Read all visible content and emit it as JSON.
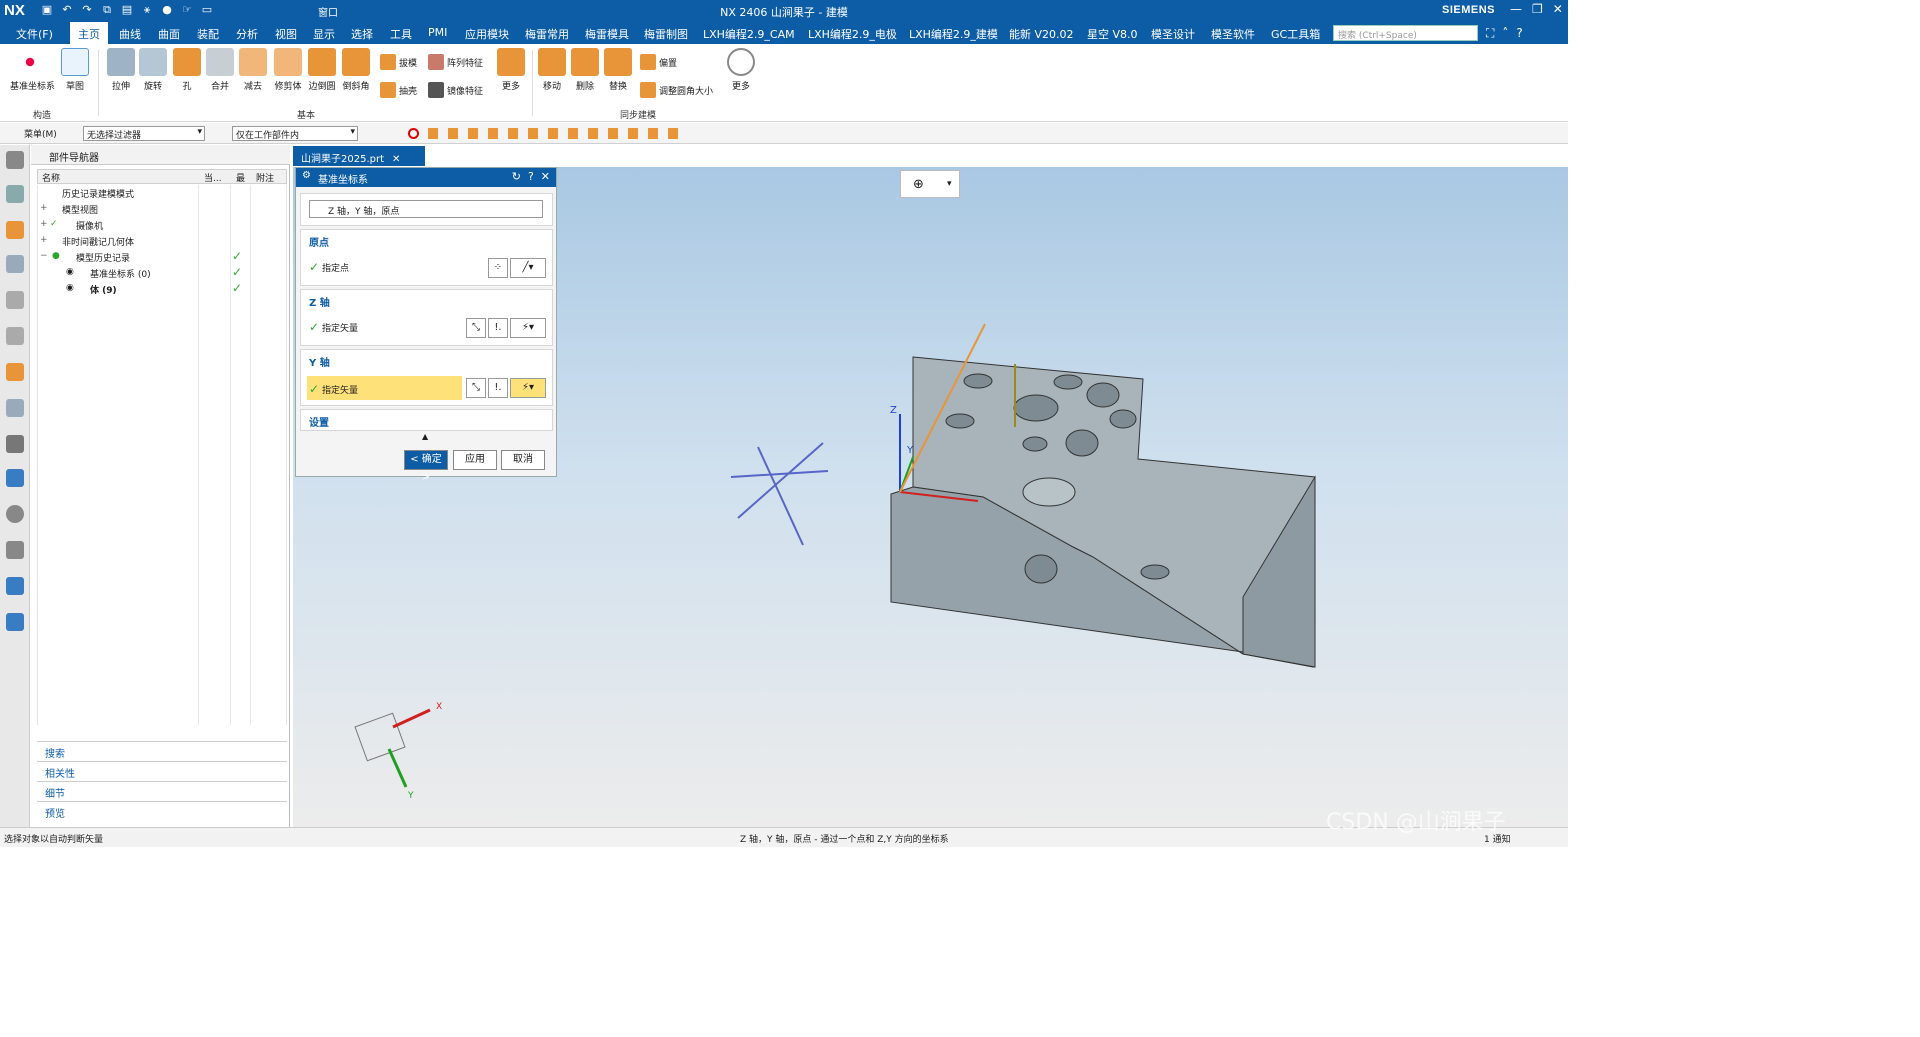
{
  "window": {
    "logo": "NX",
    "title": "NX 2406 山涧果子 - 建模",
    "brand": "SIEMENS",
    "quick_window_label": "窗口"
  },
  "menu": {
    "file": "文件(F)",
    "tabs": [
      "主页",
      "曲线",
      "曲面",
      "装配",
      "分析",
      "视图",
      "显示",
      "选择",
      "工具",
      "PMI",
      "应用模块",
      "梅雷常用",
      "梅雷模具",
      "梅雷制图",
      "LXH编程2.9_CAM",
      "LXH编程2.9_电极",
      "LXH编程2.9_建模",
      "能新 V20.02",
      "星空 V8.0",
      "模圣设计",
      "模圣软件",
      "GC工具箱"
    ],
    "active_tab": "主页",
    "search_placeholder": "搜索 (Ctrl+Space)"
  },
  "ribbon": {
    "big_buttons": [
      "基准坐标系",
      "草图",
      "拉伸",
      "旋转",
      "孔",
      "合并",
      "减去",
      "修剪体",
      "边倒圆",
      "倒斜角",
      "更多",
      "移动",
      "删除",
      "替换",
      "更多"
    ],
    "small_buttons": [
      "拔模",
      "抽壳",
      "阵列特征",
      "镜像特征",
      "偏置",
      "调整圆角大小"
    ],
    "groups": [
      "构造",
      "基本",
      "同步建模"
    ]
  },
  "toolbar": {
    "menu_label": "菜单(M)",
    "filter": "无选择过滤器",
    "scope": "仅在工作部件内"
  },
  "navigator": {
    "title": "部件导航器",
    "columns": [
      "名称",
      "当...",
      "最",
      "附注"
    ],
    "rows": [
      "历史记录建模模式",
      "模型视图",
      "摄像机",
      "非时间戳记几何体",
      "模型历史记录",
      "基准坐标系 (0)",
      "体 (9)"
    ],
    "accordion": [
      "搜索",
      "相关性",
      "细节",
      "预览"
    ]
  },
  "document": {
    "tab": "山涧果子2025.prt"
  },
  "dialog": {
    "title": "基准坐标系",
    "type": "Z 轴，Y 轴，原点",
    "sections": [
      "原点",
      "Z 轴",
      "Y 轴",
      "设置"
    ],
    "rows": [
      "指定点",
      "指定矢量",
      "指定矢量"
    ],
    "buttons": {
      "ok": "< 确定 >",
      "apply": "应用",
      "cancel": "取消"
    }
  },
  "viewport": {
    "axis_labels": [
      "Z",
      "Y",
      "X",
      "Y"
    ],
    "triad_labels": [
      "X",
      "Y"
    ]
  },
  "status": {
    "left": "选择对象以自动判断矢量",
    "center": "Z 轴，Y 轴，原点 - 通过一个点和 Z,Y 方向的坐标系",
    "watermark": "CSDN @山涧果子",
    "notice": "1 通知"
  },
  "colors": {
    "title_blue": "#0d5ca6",
    "highlight": "#ffe17a",
    "check_green": "#2ca52c",
    "model_gray": "#a8b4ba"
  }
}
